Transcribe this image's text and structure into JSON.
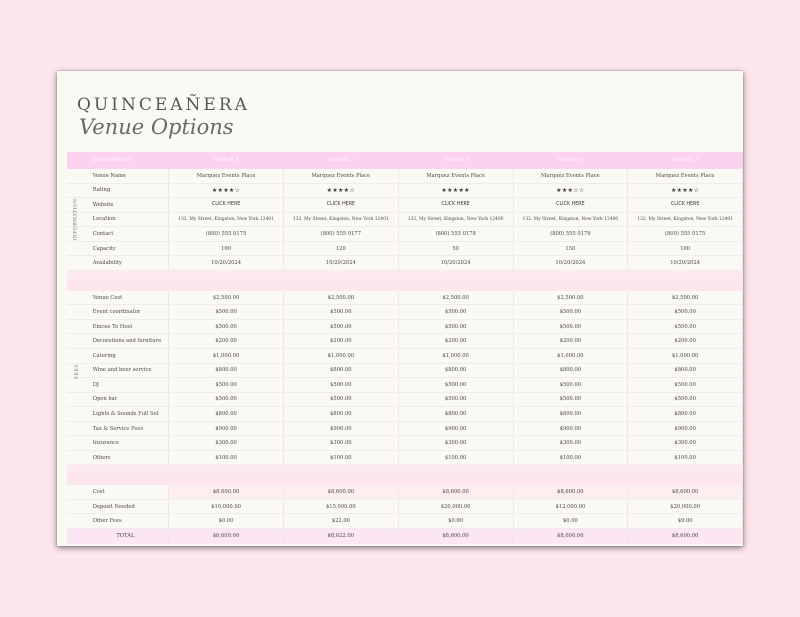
{
  "title": {
    "main": "QUINCEAÑERA",
    "sub": "Venue Options"
  },
  "header": {
    "description": "DESCRIPTION",
    "venues": [
      "VENUE 1",
      "VENUE 2",
      "VENUE 3",
      "VENUE 4",
      "VENUE 5"
    ]
  },
  "sections": {
    "information": "INFORMATION",
    "fees": "FEES"
  },
  "info_rows": [
    {
      "label": "Venue Name",
      "values": [
        "Marquez Events Place",
        "Marquez Events Place",
        "Marquez Events Place",
        "Marquez Events Place",
        "Marquez Events Place"
      ]
    },
    {
      "label": "Rating",
      "values": [
        "★★★★☆",
        "★★★★☆",
        "★★★★★",
        "★★★☆☆",
        "★★★★☆"
      ]
    },
    {
      "label": "Website",
      "values": [
        "CLICK HERE",
        "CLICK HERE",
        "CLICK HERE",
        "CLICK HERE",
        "CLICK HERE"
      ]
    },
    {
      "label": "Location",
      "values": [
        "132, My Street, Kingston, New York 12401",
        "132, My Street, Kingston, New York 12401",
        "132, My Street, Kingston, New York 12400",
        "132, My Street, Kingston, New York 12400",
        "132, My Street, Kingston, New York 12401"
      ]
    },
    {
      "label": "Contact",
      "values": [
        "(800) 555 0175",
        "(800) 555 0177",
        "(800) 555 0178",
        "(800) 555 0179",
        "(800) 555 0175"
      ]
    },
    {
      "label": "Capacity",
      "values": [
        "100",
        "120",
        "50",
        "150",
        "100"
      ]
    },
    {
      "label": "Availability",
      "values": [
        "10/20/2024",
        "10/20/2024",
        "10/20/2024",
        "10/20/2024",
        "10/20/2024"
      ]
    }
  ],
  "fee_rows": [
    {
      "label": "Venue Cost",
      "values": [
        "$2,500.00",
        "$2,500.00",
        "$2,500.00",
        "$2,500.00",
        "$2,500.00"
      ]
    },
    {
      "label": "Event coordinator",
      "values": [
        "$500.00",
        "$500.00",
        "$500.00",
        "$500.00",
        "$500.00"
      ]
    },
    {
      "label": "Emcee To Host",
      "values": [
        "$500.00",
        "$500.00",
        "$500.00",
        "$500.00",
        "$500.00"
      ]
    },
    {
      "label": "Decorations and furniture",
      "values": [
        "$200.00",
        "$200.00",
        "$200.00",
        "$200.00",
        "$200.00"
      ]
    },
    {
      "label": "Catering",
      "values": [
        "$1,000.00",
        "$1,000.00",
        "$1,000.00",
        "$1,000.00",
        "$1,000.00"
      ]
    },
    {
      "label": "Wine and beer service",
      "values": [
        "$800.00",
        "$800.00",
        "$800.00",
        "$800.00",
        "$800.00"
      ]
    },
    {
      "label": "DJ",
      "values": [
        "$500.00",
        "$500.00",
        "$500.00",
        "$500.00",
        "$500.00"
      ]
    },
    {
      "label": "Open bar",
      "values": [
        "$500.00",
        "$500.00",
        "$500.00",
        "$500.00",
        "$500.00"
      ]
    },
    {
      "label": "Lights & Sounds Full Set",
      "values": [
        "$800.00",
        "$800.00",
        "$800.00",
        "$800.00",
        "$800.00"
      ]
    },
    {
      "label": "Tax & Service Fees",
      "values": [
        "$900.00",
        "$900.00",
        "$900.00",
        "$900.00",
        "$900.00"
      ]
    },
    {
      "label": "Insurance",
      "values": [
        "$300.00",
        "$300.00",
        "$300.00",
        "$300.00",
        "$300.00"
      ]
    },
    {
      "label": "Others",
      "values": [
        "$100.00",
        "$100.00",
        "$100.00",
        "$100.00",
        "$100.00"
      ]
    }
  ],
  "summary_rows": [
    {
      "label": "Cost",
      "values": [
        "$8,600.00",
        "$8,600.00",
        "$8,600.00",
        "$8,600.00",
        "$8,600.00"
      ]
    },
    {
      "label": "Deposit Needed",
      "values": [
        "$10,000.00",
        "$15,000.00",
        "$20,000.00",
        "$12,000.00",
        "$20,000.00"
      ]
    },
    {
      "label": "Other Fees",
      "values": [
        "$0.00",
        "$22.00",
        "$0.00",
        "$0.00",
        "$9.00"
      ]
    }
  ],
  "total_row": {
    "label": "TOTAL",
    "values": [
      "$8,600.00",
      "$8,622.00",
      "$8,600.00",
      "$8,600.00",
      "$8,600.00"
    ]
  },
  "colors": {
    "header_pink": "#fcd3ee",
    "background": "#fde6ee",
    "sheet": "#fbf9f4"
  }
}
